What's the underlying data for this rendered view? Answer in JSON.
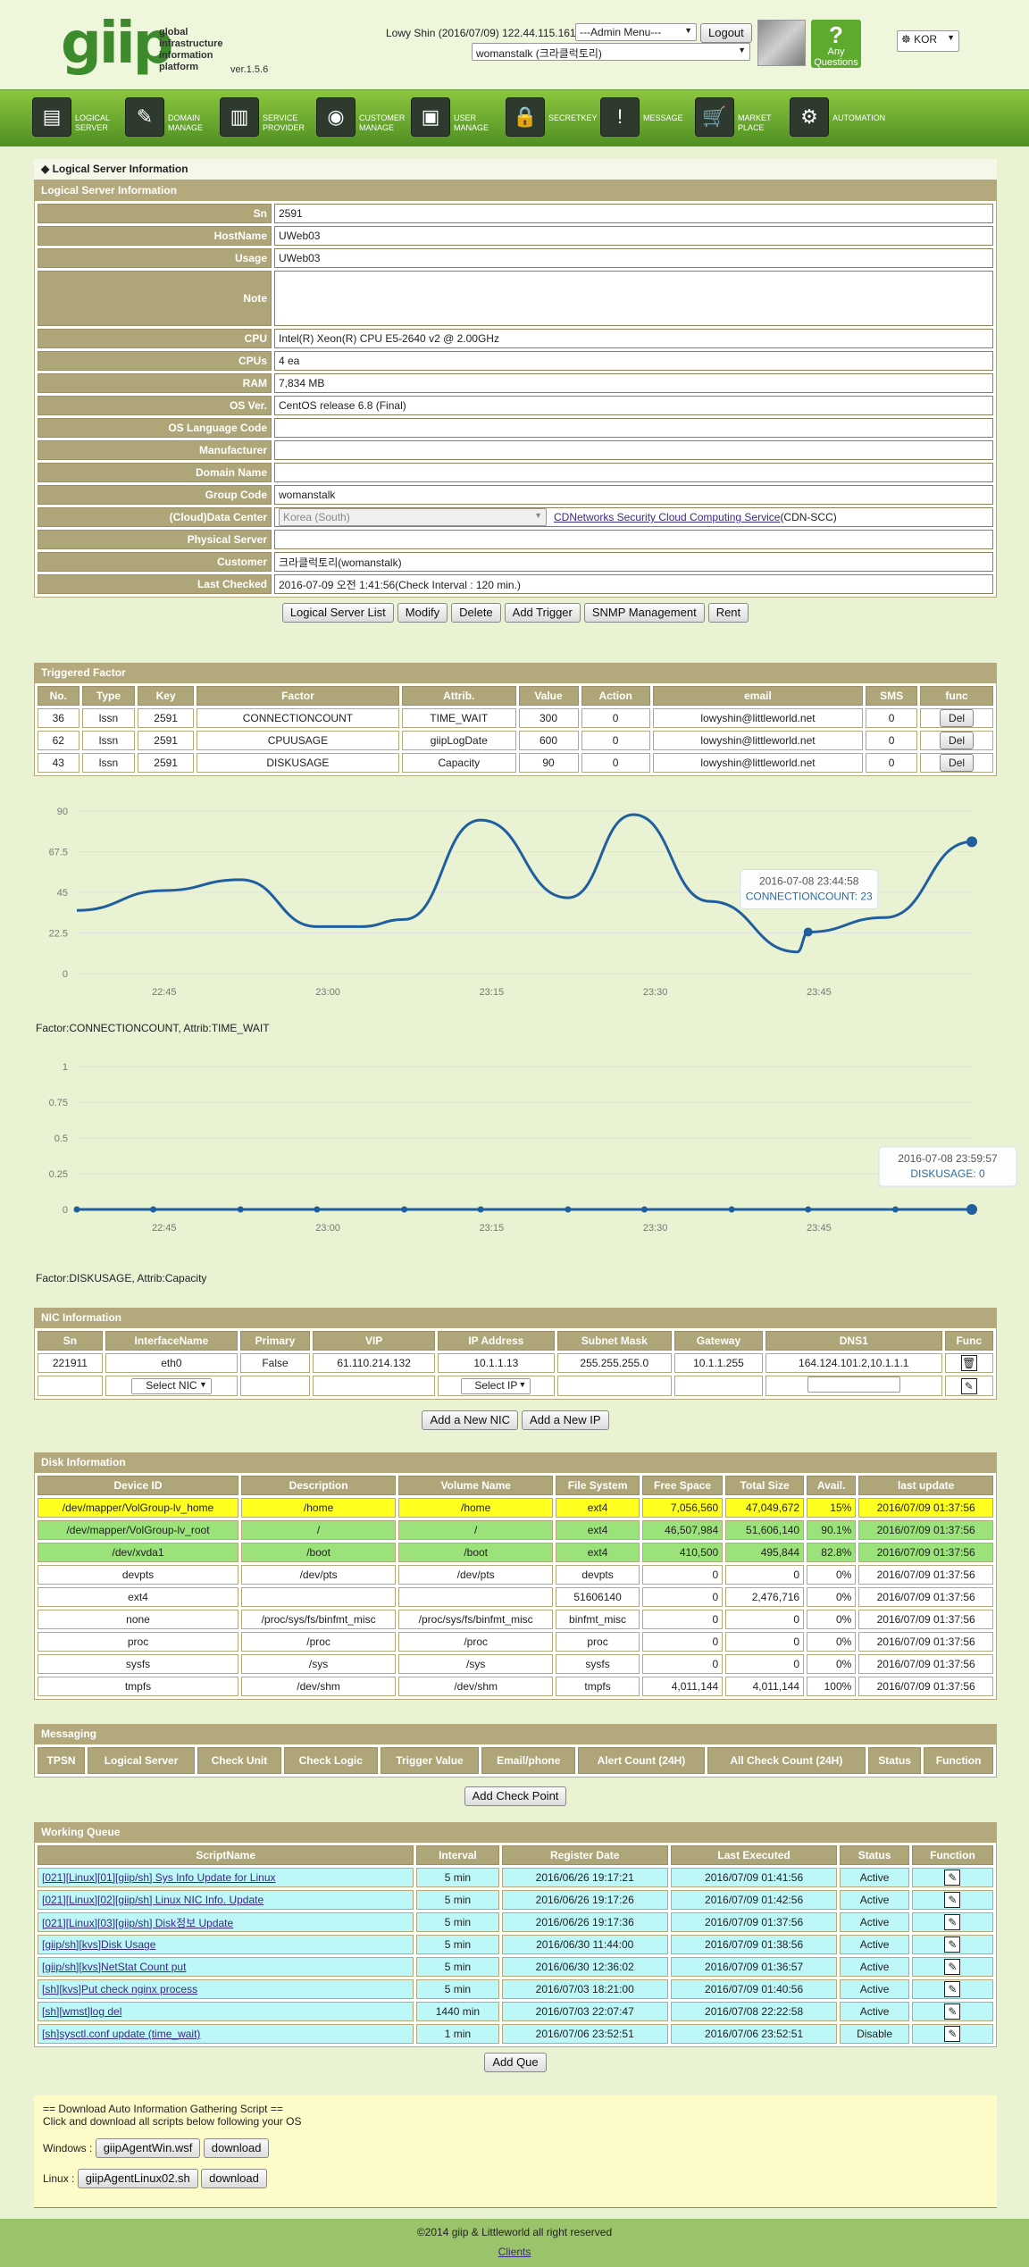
{
  "header": {
    "logo_word": "giip",
    "logo_sub": "global infrastructure information platform",
    "version": "ver.1.5.6",
    "user_info": "Lowy Shin (2016/07/09) 122.44.115.161",
    "admin_menu": "---Admin Menu---",
    "logout": "Logout",
    "project": "womanstalk (크라클럭토리)",
    "any_questions": "Any Questions",
    "lang": "KOR"
  },
  "nav": [
    {
      "icon": "▤",
      "label": "LOGICAL\nSERVER"
    },
    {
      "icon": "✎",
      "label": "DOMAIN\nMANAGE"
    },
    {
      "icon": "▥",
      "label": "SERVICE\nPROVIDER"
    },
    {
      "icon": "◉",
      "label": "CUSTOMER\nMANAGE"
    },
    {
      "icon": "▣",
      "label": "USER\nMANAGE"
    },
    {
      "icon": "🔒",
      "label": "SECRETKEY"
    },
    {
      "icon": "!",
      "label": "MESSAGE"
    },
    {
      "icon": "🛒",
      "label": "MARKET\nPLACE"
    },
    {
      "icon": "⚙",
      "label": "AUTOMATION"
    }
  ],
  "page_title": "◆ Logical Server Information",
  "lsi": {
    "title": "Logical Server Information",
    "rows": [
      {
        "k": "Sn",
        "v": "2591"
      },
      {
        "k": "HostName",
        "v": "UWeb03"
      },
      {
        "k": "Usage",
        "v": "UWeb03"
      },
      {
        "k": "Note",
        "v": ""
      },
      {
        "k": "CPU",
        "v": "Intel(R) Xeon(R) CPU E5-2640 v2 @ 2.00GHz"
      },
      {
        "k": "CPUs",
        "v": "4 ea"
      },
      {
        "k": "RAM",
        "v": "7,834 MB"
      },
      {
        "k": "OS Ver.",
        "v": "CentOS release 6.8 (Final)"
      },
      {
        "k": "OS Language Code",
        "v": ""
      },
      {
        "k": "Manufacturer",
        "v": ""
      },
      {
        "k": "Domain Name",
        "v": ""
      },
      {
        "k": "Group Code",
        "v": "womanstalk"
      },
      {
        "k": "(Cloud)Data Center",
        "v": ""
      },
      {
        "k": "Physical Server",
        "v": ""
      },
      {
        "k": "Customer",
        "v": "크라클럭토리(womanstalk)"
      },
      {
        "k": "Last Checked",
        "v": "2016-07-09 오전 1:41:56(Check Interval : 120 min.)"
      }
    ],
    "dc_select": "Korea (South)",
    "dc_link": "CDNetworks Security Cloud Computing Service",
    "dc_code": "(CDN-SCC)",
    "buttons": [
      "Logical Server List",
      "Modify",
      "Delete",
      "Add Trigger",
      "SNMP Management",
      "Rent"
    ]
  },
  "triggered": {
    "title": "Triggered Factor",
    "headers": [
      "No.",
      "Type",
      "Key",
      "Factor",
      "Attrib.",
      "Value",
      "Action",
      "email",
      "SMS",
      "func"
    ],
    "rows": [
      [
        "36",
        "lssn",
        "2591",
        "CONNECTIONCOUNT",
        "TIME_WAIT",
        "300",
        "0",
        "lowyshin@littleworld.net",
        "0"
      ],
      [
        "62",
        "lssn",
        "2591",
        "CPUUSAGE",
        "giipLogDate",
        "600",
        "0",
        "lowyshin@littleworld.net",
        "0"
      ],
      [
        "43",
        "lssn",
        "2591",
        "DISKUSAGE",
        "Capacity",
        "90",
        "0",
        "lowyshin@littleworld.net",
        "0"
      ]
    ],
    "del": "Del"
  },
  "chart_data": [
    {
      "type": "line",
      "title": "",
      "xlabel": "",
      "ylabel": "",
      "ylim": [
        0,
        90
      ],
      "yticks": [
        "0",
        "22.5",
        "45",
        "67.5",
        "90"
      ],
      "xticks": [
        "22:45",
        "23:00",
        "23:15",
        "23:30",
        "23:45"
      ],
      "x_range": [
        "22:37",
        "23:54"
      ],
      "series": [
        {
          "values": [
            [
              "22:37",
              35
            ],
            [
              "22:45",
              46
            ],
            [
              "22:52",
              52
            ],
            [
              "22:59",
              26
            ],
            [
              "23:03",
              26
            ],
            [
              "23:07",
              30
            ],
            [
              "23:14",
              85
            ],
            [
              "23:22",
              42
            ],
            [
              "23:28",
              88
            ],
            [
              "23:35",
              40
            ],
            [
              "23:43",
              12
            ],
            [
              "23:44",
              23
            ],
            [
              "23:51",
              31
            ],
            [
              "23:59",
              73
            ]
          ]
        }
      ],
      "tooltip_time": "2016-07-08 23:44:58",
      "tooltip_value": "CONNECTIONCOUNT: 23",
      "caption": "Factor:CONNECTIONCOUNT, Attrib:TIME_WAIT",
      "color": "#1f5fa0"
    },
    {
      "type": "line",
      "title": "",
      "xlabel": "",
      "ylabel": "",
      "ylim": [
        0,
        1
      ],
      "yticks": [
        "0",
        "0.25",
        "0.5",
        "0.75",
        "1"
      ],
      "xticks": [
        "22:45",
        "23:00",
        "23:15",
        "23:30",
        "23:45"
      ],
      "x_range": [
        "22:37",
        "23:54"
      ],
      "series": [
        {
          "values": [
            [
              "22:37",
              0
            ],
            [
              "22:44",
              0
            ],
            [
              "22:52",
              0
            ],
            [
              "22:59",
              0
            ],
            [
              "23:07",
              0
            ],
            [
              "23:14",
              0
            ],
            [
              "23:22",
              0
            ],
            [
              "23:29",
              0
            ],
            [
              "23:37",
              0
            ],
            [
              "23:44",
              0
            ],
            [
              "23:52",
              0
            ],
            [
              "23:59",
              0
            ]
          ]
        }
      ],
      "tooltip_time": "2016-07-08 23:59:57",
      "tooltip_value": "DISKUSAGE: 0",
      "caption": "Factor:DISKUSAGE, Attrib:Capacity",
      "color": "#1f5fa0"
    }
  ],
  "nic": {
    "title": "NIC Information",
    "headers": [
      "Sn",
      "InterfaceName",
      "Primary",
      "VIP",
      "IP Address",
      "Subnet Mask",
      "Gateway",
      "DNS1",
      "Func"
    ],
    "row": [
      "221911",
      "eth0",
      "False",
      "61.110.214.132",
      "10.1.1.13",
      "255.255.255.0",
      "10.1.1.255",
      "164.124.101.2,10.1.1.1"
    ],
    "select_nic": "Select NIC",
    "select_ip": "Select IP",
    "buttons": [
      "Add a New NIC",
      "Add a New IP"
    ]
  },
  "disk": {
    "title": "Disk Information",
    "headers": [
      "Device ID",
      "Description",
      "Volume Name",
      "File System",
      "Free Space",
      "Total Size",
      "Avail.",
      "last update"
    ],
    "rows": [
      {
        "c": "yellow",
        "v": [
          "/dev/mapper/VolGroup-lv_home",
          "/home",
          "/home",
          "ext4",
          "7,056,560",
          "47,049,672",
          "15%",
          "2016/07/09 01:37:56"
        ]
      },
      {
        "c": "green",
        "v": [
          "/dev/mapper/VolGroup-lv_root",
          "/",
          "/",
          "ext4",
          "46,507,984",
          "51,606,140",
          "90.1%",
          "2016/07/09 01:37:56"
        ]
      },
      {
        "c": "green",
        "v": [
          "/dev/xvda1",
          "/boot",
          "/boot",
          "ext4",
          "410,500",
          "495,844",
          "82.8%",
          "2016/07/09 01:37:56"
        ]
      },
      {
        "c": "",
        "v": [
          "devpts",
          "/dev/pts",
          "/dev/pts",
          "devpts",
          "0",
          "0",
          "0%",
          "2016/07/09 01:37:56"
        ]
      },
      {
        "c": "",
        "v": [
          "ext4",
          "",
          "",
          "51606140",
          "0",
          "2,476,716",
          "0%",
          "2016/07/09 01:37:56"
        ]
      },
      {
        "c": "",
        "v": [
          "none",
          "/proc/sys/fs/binfmt_misc",
          "/proc/sys/fs/binfmt_misc",
          "binfmt_misc",
          "0",
          "0",
          "0%",
          "2016/07/09 01:37:56"
        ]
      },
      {
        "c": "",
        "v": [
          "proc",
          "/proc",
          "/proc",
          "proc",
          "0",
          "0",
          "0%",
          "2016/07/09 01:37:56"
        ]
      },
      {
        "c": "",
        "v": [
          "sysfs",
          "/sys",
          "/sys",
          "sysfs",
          "0",
          "0",
          "0%",
          "2016/07/09 01:37:56"
        ]
      },
      {
        "c": "",
        "v": [
          "tmpfs",
          "/dev/shm",
          "/dev/shm",
          "tmpfs",
          "4,011,144",
          "4,011,144",
          "100%",
          "2016/07/09 01:37:56"
        ]
      }
    ]
  },
  "messaging": {
    "title": "Messaging",
    "headers": [
      "TPSN",
      "Logical Server",
      "Check Unit",
      "Check Logic",
      "Trigger Value",
      "Email/phone",
      "Alert Count (24H)",
      "All Check Count (24H)",
      "Status",
      "Function"
    ],
    "button": "Add Check Point"
  },
  "queue": {
    "title": "Working Queue",
    "headers": [
      "ScriptName",
      "Interval",
      "Register Date",
      "Last Executed",
      "Status",
      "Function"
    ],
    "rows": [
      [
        "[021][Linux][01][giip/sh] Sys Info Update for Linux",
        "5 min",
        "2016/06/26 19:17:21",
        "2016/07/09 01:41:56",
        "Active"
      ],
      [
        "[021][Linux][02][giip/sh] Linux NIC Info. Update",
        "5 min",
        "2016/06/26 19:17:26",
        "2016/07/09 01:42:56",
        "Active"
      ],
      [
        "[021][Linux][03][giip/sh] Disk정보 Update",
        "5 min",
        "2016/06/26 19:17:36",
        "2016/07/09 01:37:56",
        "Active"
      ],
      [
        "[giip/sh][kvs]Disk Usage",
        "5 min",
        "2016/06/30 11:44:00",
        "2016/07/09 01:38:56",
        "Active"
      ],
      [
        "[giip/sh][kvs]NetStat Count put",
        "5 min",
        "2016/06/30 12:36:02",
        "2016/07/09 01:36:57",
        "Active"
      ],
      [
        "[sh][kvs]Put check nginx process",
        "5 min",
        "2016/07/03 18:21:00",
        "2016/07/09 01:40:56",
        "Active"
      ],
      [
        "[sh][wmst]log del",
        "1440 min",
        "2016/07/03 22:07:47",
        "2016/07/08 22:22:58",
        "Active"
      ],
      [
        "[sh]sysctl.conf update (time_wait)",
        "1 min",
        "2016/07/06 23:52:51",
        "2016/07/06 23:52:51",
        "Disable"
      ]
    ],
    "button": "Add Que"
  },
  "download": {
    "title": "== Download Auto Information Gathering Script ==",
    "sub": "Click and download all scripts below following your OS",
    "windows_label": "Windows :",
    "windows_file": "giipAgentWin.wsf",
    "linux_label": "Linux :",
    "linux_file": "giipAgentLinux02.sh",
    "download": "download"
  },
  "footer": {
    "copyright": "©2014 giip & Littleworld all right reserved",
    "link": "Clients"
  }
}
